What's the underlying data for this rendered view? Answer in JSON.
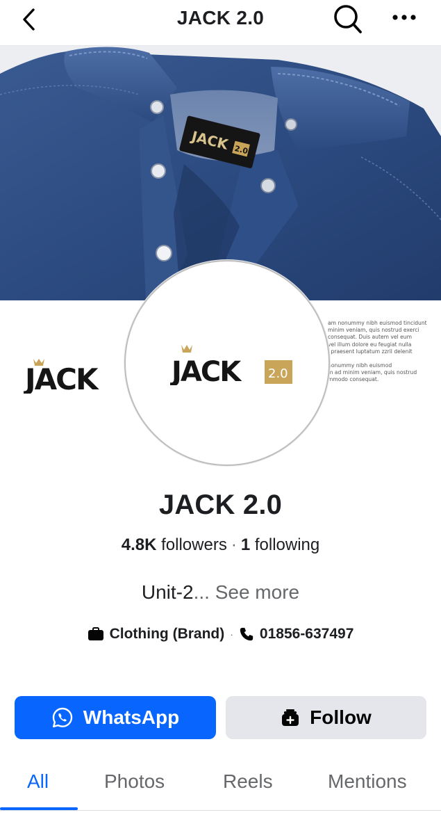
{
  "header": {
    "title": "JACK 2.0",
    "back_icon": "chevron-left-icon",
    "search_icon": "search-icon",
    "more_icon": "more-horizontal-icon"
  },
  "cover": {
    "label_text": "JACK",
    "label_badge": "2.0",
    "side_logo_text": "JACK",
    "lorem_lines": [
      "am nonummy nibh euismod tincidunt",
      "minim veniam, quis nostrud exerci",
      "consequat. Duis autem vel eum",
      "vel illum dolore eu feugiat nulla",
      "i praesent luptatum zzril delenit",
      "",
      "nonummy nibh euismod",
      "m ad minim veniam, quis nostrud",
      "mmodo consequat."
    ]
  },
  "avatar": {
    "logo_text": "JACK",
    "logo_badge": "2.0"
  },
  "profile": {
    "name": "JACK 2.0",
    "followers_count": "4.8K",
    "followers_label": "followers",
    "separator": "·",
    "following_count": "1",
    "following_label": "following",
    "bio_text": "Unit-2",
    "bio_ellipsis": "...",
    "see_more": "See more",
    "category": "Clothing (Brand)",
    "detail_separator": "·",
    "phone": "01856-637497"
  },
  "actions": {
    "whatsapp_label": "WhatsApp",
    "follow_label": "Follow"
  },
  "tabs": [
    {
      "label": "All",
      "active": true
    },
    {
      "label": "Photos",
      "active": false
    },
    {
      "label": "Reels",
      "active": false
    },
    {
      "label": "Mentions",
      "active": false
    }
  ],
  "colors": {
    "accent": "#0866ff",
    "denim": "#2f4e84",
    "gold": "#c9a55a",
    "follow_bg": "#e4e6eb"
  }
}
